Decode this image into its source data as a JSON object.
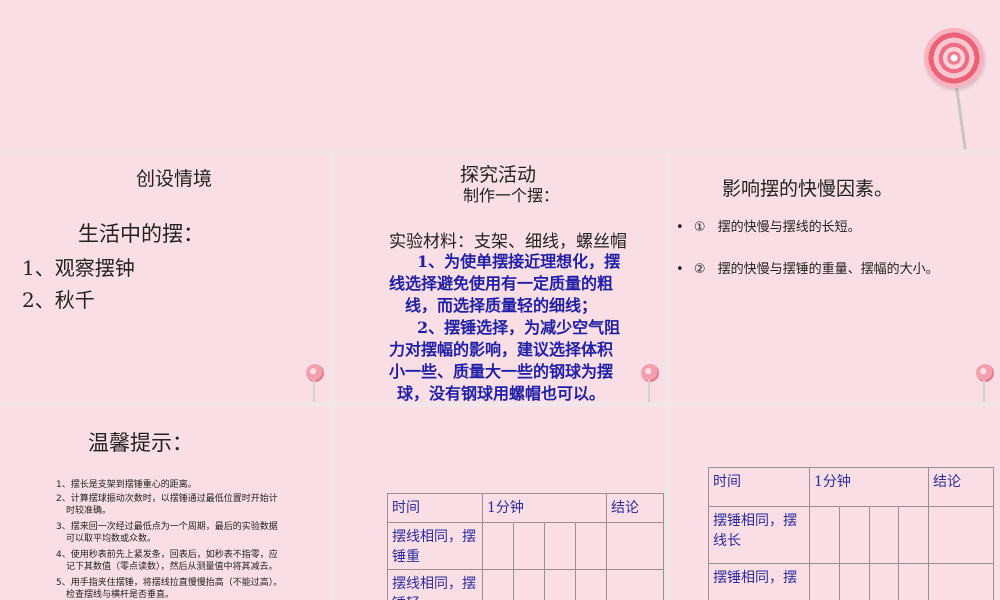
{
  "panel1": {
    "title": "创设情境",
    "subtitle": "生活中的摆：",
    "items": [
      "1、观察摆钟",
      "2、秋千"
    ]
  },
  "panel2": {
    "title": "探究活动",
    "subtitle": "制作一个摆：",
    "materials": "实验材料：支架、细线，螺丝帽",
    "lines": [
      "1、为使单摆接近理想化，摆",
      "线选择避免使用有一定质量的粗",
      "线，而选择质量轻的细线；",
      "2、摆锤选择，为减少空气阻",
      "力对摆幅的影响，建议选择体积",
      "小一些、质量大一些的钢球为摆",
      "球，没有钢球用螺帽也可以。"
    ]
  },
  "panel3": {
    "title": "影响摆的快慢因素。",
    "bullets": [
      {
        "bullet": "•",
        "num": "①",
        "text": "摆的快慢与摆线的长短。"
      },
      {
        "bullet": "•",
        "num": "②",
        "text": "摆的快慢与摆锤的重量、摆幅的大小。"
      }
    ]
  },
  "panel4": {
    "title": "温馨提示：",
    "tips": [
      "1、摆长是支架到摆锤重心的距离。",
      "2、计算摆球振动次数时，以摆锤通过最低位置时开始计",
      "时较准确。",
      "3、摆来回一次经过最低点为一个周期，最后的实验数据",
      "可以取平均数或众数。",
      "4、使用秒表前先上紧发条，回表后，如秒表不指零，应",
      "记下其数值（零点读数），然后从测量值中将其减去。",
      "5、用手指夹住摆锤，将摆线拉直慢慢抬高（不能过高）。",
      "检查摆线与横杆是否垂直。"
    ]
  },
  "table1": {
    "headers": [
      "时间",
      "1分钟",
      "结论"
    ],
    "rows": [
      "摆线相同，摆锤重",
      "摆线相同，摆锤轻"
    ]
  },
  "table2": {
    "headers": [
      "时间",
      "1分钟",
      "结论"
    ],
    "rows": [
      "摆锤相同，摆线长",
      "摆锤相同，摆"
    ]
  }
}
